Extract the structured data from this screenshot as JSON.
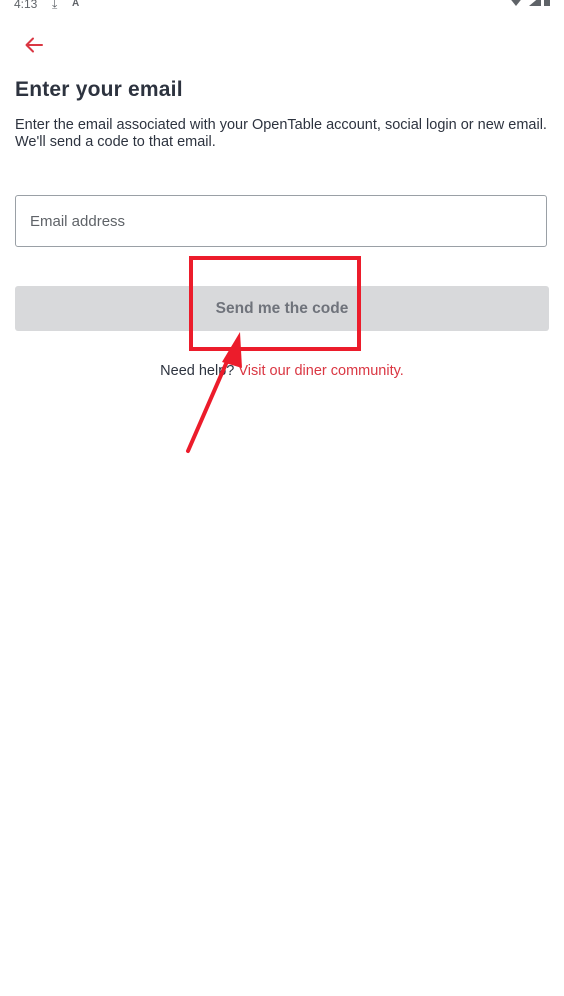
{
  "status_bar": {
    "time": "4:13",
    "icons": [
      "download-icon",
      "a-badge-icon",
      "wifi-icon",
      "signal-icon",
      "battery-icon"
    ]
  },
  "header": {
    "back_icon": "arrow-left-icon",
    "title": "Enter your email",
    "description": "Enter the email associated with your OpenTable account, social login or new email. We'll send a code to that email."
  },
  "form": {
    "email_placeholder": "Email address",
    "email_value": "",
    "send_button_label": "Send me the code"
  },
  "help": {
    "text": "Need help?",
    "link_label": "Visit our diner community."
  },
  "colors": {
    "accent": "#da3743",
    "annotation": "#ec1c2b",
    "button_disabled_bg": "#d8d9db",
    "button_disabled_text": "#6f737b"
  }
}
